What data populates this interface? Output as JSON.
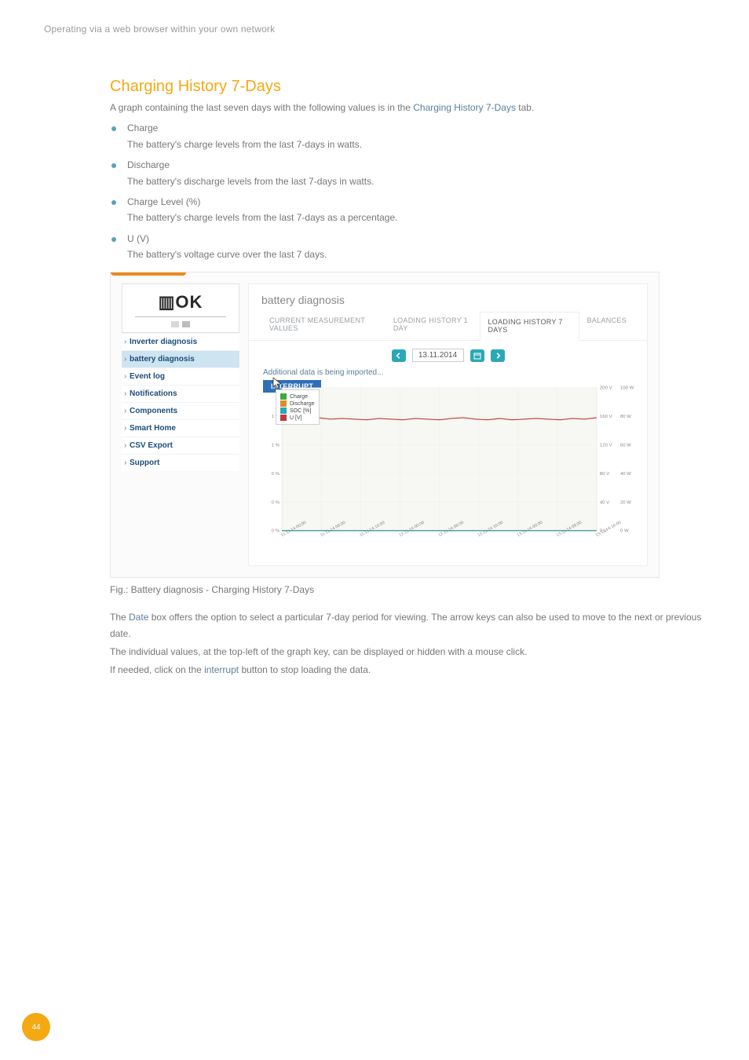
{
  "header": "Operating via a web browser within your own network",
  "section_title": "Charging History 7-Days",
  "intro_prefix": "A graph containing the last seven days with the following values is in the ",
  "intro_link": "Charging History 7-Days",
  "intro_suffix": " tab.",
  "bullets": [
    {
      "label": "Charge",
      "desc": "The battery's charge levels from the last 7-days in watts."
    },
    {
      "label": "Discharge",
      "desc": "The battery's discharge levels from the last 7-days in watts."
    },
    {
      "label": "Charge Level (%)",
      "desc": "The battery's charge levels from the last 7-days as a percentage."
    },
    {
      "label": "U (V)",
      "desc": "The battery's voltage curve over the last 7 days."
    }
  ],
  "screenshot": {
    "panel_title": "battery diagnosis",
    "tabs": [
      "CURRENT MEASUREMENT VALUES",
      "LOADING HISTORY 1 DAY",
      "LOADING HISTORY 7 DAYS",
      "BALANCES"
    ],
    "active_tab_index": 2,
    "date_value": "13.11.2014",
    "loading_text": "Additional data is being imported...",
    "interrupt_label": "INTERRUPT",
    "sidebar_items": [
      "Inverter diagnosis",
      "battery diagnosis",
      "Event log",
      "Notifications",
      "Components",
      "Smart Home",
      "CSV Export",
      "Support"
    ],
    "sidebar_active_index": 1,
    "legend": [
      {
        "name": "Charge",
        "color": "#3caa3c"
      },
      {
        "name": "Discharge",
        "color": "#e08a2a"
      },
      {
        "name": "SOC [%]",
        "color": "#2aa8b8"
      },
      {
        "name": "U [V]",
        "color": "#c03a3a"
      }
    ]
  },
  "chart_data": {
    "type": "line",
    "title": "",
    "xlabel": "",
    "x_ticks": [
      "11.11.14 00:00",
      "11.11.14 08:00",
      "11.11.14 16:00",
      "12.11.14 00:00",
      "12.11.14 08:00",
      "12.11.14 16:00",
      "13.11.14 00:00",
      "13.11.14 08:00",
      "13.11.14 16:00"
    ],
    "left_axis": {
      "label": "%",
      "ticks": [
        "0 %",
        "0 %",
        "0 %",
        "1 %",
        "1 %",
        "1 %"
      ],
      "lim": [
        0,
        1.5
      ]
    },
    "right_axis_volts": {
      "label": "V",
      "ticks": [
        "0 V",
        "40 V",
        "80 V",
        "120 V",
        "160 V",
        "200 V"
      ],
      "lim": [
        0,
        200
      ]
    },
    "right_axis_watts": {
      "label": "W",
      "ticks": [
        "0 W",
        "20 W",
        "40 W",
        "60 W",
        "80 W",
        "100 W"
      ],
      "lim": [
        0,
        100
      ]
    },
    "series": [
      {
        "name": "Charge",
        "axis": "watts",
        "color": "#3caa3c",
        "values": [
          0,
          0,
          0,
          0,
          0,
          0,
          0,
          0,
          0,
          0,
          0,
          0,
          0,
          0,
          0,
          0,
          0,
          0,
          0,
          0,
          0,
          0,
          0,
          0,
          0,
          0,
          0
        ]
      },
      {
        "name": "Discharge",
        "axis": "watts",
        "color": "#e08a2a",
        "values": [
          0,
          0,
          0,
          0,
          0,
          0,
          0,
          0,
          0,
          0,
          0,
          0,
          0,
          0,
          0,
          0,
          0,
          0,
          0,
          0,
          0,
          0,
          0,
          0,
          0,
          0,
          0
        ]
      },
      {
        "name": "SOC [%]",
        "axis": "percent",
        "color": "#2aa8b8",
        "values": [
          0,
          0,
          0,
          0,
          0,
          0,
          0,
          0,
          0,
          0,
          0,
          0,
          0,
          0,
          0,
          0,
          0,
          0,
          0,
          0,
          0,
          0,
          0,
          0,
          0,
          0,
          0
        ]
      },
      {
        "name": "U [V]",
        "axis": "volts",
        "color": "#c03a3a",
        "values": [
          155,
          157,
          156,
          158,
          156,
          157,
          156,
          155,
          157,
          156,
          155,
          157,
          156,
          155,
          157,
          158,
          156,
          155,
          157,
          155,
          156,
          157,
          156,
          155,
          157,
          156,
          158
        ]
      }
    ]
  },
  "fig_caption": "Fig.: Battery diagnosis - Charging History 7-Days",
  "para1_a": "The ",
  "para1_link": "Date",
  "para1_b": " box offers the option to select a particular 7-day period for viewing. The arrow keys can also be used to move to the next or previous date.",
  "para2": "The individual values, at the top-left of the graph key, can be displayed or hidden with a mouse click.",
  "para3_a": "If needed, click on the ",
  "para3_link": "interrupt",
  "para3_b": " button to stop loading the data.",
  "page_number": "44"
}
